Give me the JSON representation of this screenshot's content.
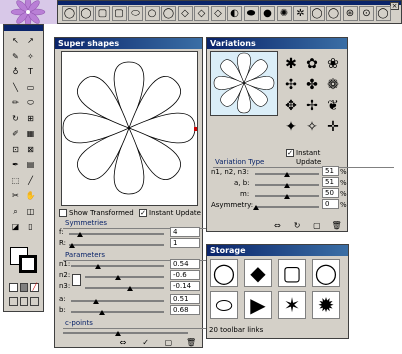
{
  "toolbar": {
    "close": "×",
    "shapes": [
      "◯",
      "◯",
      "▢",
      "▢",
      "⬭",
      "○",
      "◯",
      "◇",
      "◇",
      "◇",
      "◐",
      "⬬",
      "●",
      "✺",
      "✲",
      "◯",
      "◯",
      "⊛",
      "⊙",
      "◯"
    ]
  },
  "tools": [
    "↖",
    "↗",
    "✎",
    "✧",
    "♁",
    "T",
    "╲",
    "▭",
    "✏",
    "⬭",
    "↻",
    "⊞",
    "✐",
    "▦",
    "⊡",
    "⊠",
    "✒",
    "▤",
    "⬚",
    "╱",
    "✂",
    "✋",
    "⌕",
    "◫",
    "◪",
    "▯"
  ],
  "superShapes": {
    "title": "Super shapes",
    "showTransformed": "Show Transformed",
    "instantUpdate": "Instant Update",
    "symmetries": {
      "label": "Symmetries",
      "fLabel": "f:",
      "fValue": "4",
      "rLabel": "R:",
      "rValue": "1"
    },
    "parameters": {
      "label": "Parameters",
      "n1": "n1:",
      "n1v": "0.54",
      "n2": "n2:",
      "n2v": "-0.6",
      "n3": "n3:",
      "n3v": "-0.14",
      "a": "a:",
      "av": "0.51",
      "b": "b:",
      "bv": "0.68"
    },
    "cpoints": "c-points"
  },
  "variations": {
    "title": "Variations",
    "instantUpdate": "Instant Update",
    "variationType": "Variation Type",
    "n1n2n3": "n1, n2, n3:",
    "n1n2n3v": "51",
    "ab": "a, b:",
    "abv": "51",
    "m": "m:",
    "mv": "50",
    "asym": "Asymmetry:",
    "asymv": "0",
    "pct": "%"
  },
  "storage": {
    "title": "Storage",
    "status": "20 toolbar links"
  }
}
